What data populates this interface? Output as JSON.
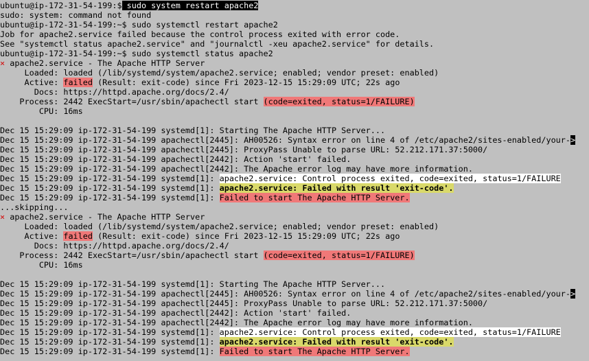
{
  "terminal": {
    "background": "#c0c0c0",
    "colors": {
      "prompt_highlight": "#000000",
      "failure_highlight": "#f07878",
      "notice_highlight": "#ffffff",
      "warning_highlight": "#d9d96a",
      "status_x": "#d40000"
    },
    "lines": [
      {
        "segs": [
          {
            "t": "ubuntu@ip-172-31-54-199:$",
            "s": "plain"
          },
          {
            "t": " sudo system restart apache2",
            "s": "black"
          }
        ]
      },
      {
        "segs": [
          {
            "t": "sudo: system: command not found",
            "s": "plain"
          }
        ]
      },
      {
        "segs": [
          {
            "t": "ubuntu@ip-172-31-54-199:~$ sudo systemctl restart apache2",
            "s": "plain"
          }
        ]
      },
      {
        "segs": [
          {
            "t": "Job for apache2.service failed because the control process exited with error code.",
            "s": "plain"
          }
        ]
      },
      {
        "segs": [
          {
            "t": "See \"systemctl status apache2.service\" and \"journalctl -xeu apache2.service\" for details.",
            "s": "plain"
          }
        ]
      },
      {
        "segs": [
          {
            "t": "ubuntu@ip-172-31-54-199:~$ sudo systemctl status apache2",
            "s": "plain"
          }
        ]
      },
      {
        "segs": [
          {
            "t": "×",
            "s": "x"
          },
          {
            "t": " apache2.service - The Apache HTTP Server",
            "s": "plain"
          }
        ]
      },
      {
        "segs": [
          {
            "t": "     Loaded: loaded (/lib/systemd/system/apache2.service; enabled; vendor preset: enabled)",
            "s": "plain"
          }
        ]
      },
      {
        "segs": [
          {
            "t": "     Active: ",
            "s": "plain"
          },
          {
            "t": "failed",
            "s": "red"
          },
          {
            "t": " (Result: exit-code) since Fri 2023-12-15 15:29:09 UTC; 22s ago",
            "s": "plain"
          }
        ]
      },
      {
        "segs": [
          {
            "t": "       Docs: https://httpd.apache.org/docs/2.4/",
            "s": "plain"
          }
        ]
      },
      {
        "segs": [
          {
            "t": "    Process: 2442 ExecStart=/usr/sbin/apachectl start ",
            "s": "plain"
          },
          {
            "t": "(code=exited, status=1/FAILURE)",
            "s": "red"
          }
        ]
      },
      {
        "segs": [
          {
            "t": "        CPU: 16ms",
            "s": "plain"
          }
        ]
      },
      {
        "segs": [
          {
            "t": "",
            "s": "plain"
          }
        ]
      },
      {
        "segs": [
          {
            "t": "Dec 15 15:29:09 ip-172-31-54-199 systemd[1]: Starting The Apache HTTP Server...",
            "s": "plain"
          }
        ]
      },
      {
        "segs": [
          {
            "t": "Dec 15 15:29:09 ip-172-31-54-199 apachectl[2445]: AH00526: Syntax error on line 4 of /etc/apache2/sites-enabled/your-",
            "s": "plain"
          },
          {
            "t": ">",
            "s": "black"
          }
        ]
      },
      {
        "segs": [
          {
            "t": "Dec 15 15:29:09 ip-172-31-54-199 apachectl[2445]: ProxyPass Unable to parse URL: 52.212.171.37:5000/",
            "s": "plain"
          }
        ]
      },
      {
        "segs": [
          {
            "t": "Dec 15 15:29:09 ip-172-31-54-199 apachectl[2442]: Action 'start' failed.",
            "s": "plain"
          }
        ]
      },
      {
        "segs": [
          {
            "t": "Dec 15 15:29:09 ip-172-31-54-199 apachectl[2442]: The Apache error log may have more information.",
            "s": "plain"
          }
        ]
      },
      {
        "segs": [
          {
            "t": "Dec 15 15:29:09 ip-172-31-54-199 systemd[1]: ",
            "s": "plain"
          },
          {
            "t": "apache2.service: Control process exited, code=exited, status=1/FAILURE",
            "s": "white"
          }
        ]
      },
      {
        "segs": [
          {
            "t": "Dec 15 15:29:09 ip-172-31-54-199 systemd[1]: ",
            "s": "plain"
          },
          {
            "t": "apache2.service: Failed with result 'exit-code'.",
            "s": "yellow"
          }
        ]
      },
      {
        "segs": [
          {
            "t": "Dec 15 15:29:09 ip-172-31-54-199 systemd[1]: ",
            "s": "plain"
          },
          {
            "t": "Failed to start The Apache HTTP Server.",
            "s": "red"
          }
        ]
      },
      {
        "segs": [
          {
            "t": "...skipping...",
            "s": "plain"
          }
        ]
      },
      {
        "segs": [
          {
            "t": "×",
            "s": "x"
          },
          {
            "t": " apache2.service - The Apache HTTP Server",
            "s": "plain"
          }
        ]
      },
      {
        "segs": [
          {
            "t": "     Loaded: loaded (/lib/systemd/system/apache2.service; enabled; vendor preset: enabled)",
            "s": "plain"
          }
        ]
      },
      {
        "segs": [
          {
            "t": "     Active: ",
            "s": "plain"
          },
          {
            "t": "failed",
            "s": "red"
          },
          {
            "t": " (Result: exit-code) since Fri 2023-12-15 15:29:09 UTC; 22s ago",
            "s": "plain"
          }
        ]
      },
      {
        "segs": [
          {
            "t": "       Docs: https://httpd.apache.org/docs/2.4/",
            "s": "plain"
          }
        ]
      },
      {
        "segs": [
          {
            "t": "    Process: 2442 ExecStart=/usr/sbin/apachectl start ",
            "s": "plain"
          },
          {
            "t": "(code=exited, status=1/FAILURE)",
            "s": "red"
          }
        ]
      },
      {
        "segs": [
          {
            "t": "        CPU: 16ms",
            "s": "plain"
          }
        ]
      },
      {
        "segs": [
          {
            "t": "",
            "s": "plain"
          }
        ]
      },
      {
        "segs": [
          {
            "t": "Dec 15 15:29:09 ip-172-31-54-199 systemd[1]: Starting The Apache HTTP Server...",
            "s": "plain"
          }
        ]
      },
      {
        "segs": [
          {
            "t": "Dec 15 15:29:09 ip-172-31-54-199 apachectl[2445]: AH00526: Syntax error on line 4 of /etc/apache2/sites-enabled/your-",
            "s": "plain"
          },
          {
            "t": ">",
            "s": "black"
          }
        ]
      },
      {
        "segs": [
          {
            "t": "Dec 15 15:29:09 ip-172-31-54-199 apachectl[2445]: ProxyPass Unable to parse URL: 52.212.171.37:5000/",
            "s": "plain"
          }
        ]
      },
      {
        "segs": [
          {
            "t": "Dec 15 15:29:09 ip-172-31-54-199 apachectl[2442]: Action 'start' failed.",
            "s": "plain"
          }
        ]
      },
      {
        "segs": [
          {
            "t": "Dec 15 15:29:09 ip-172-31-54-199 apachectl[2442]: The Apache error log may have more information.",
            "s": "plain"
          }
        ]
      },
      {
        "segs": [
          {
            "t": "Dec 15 15:29:09 ip-172-31-54-199 systemd[1]: ",
            "s": "plain"
          },
          {
            "t": "apache2.service: Control process exited, code=exited, status=1/FAILURE",
            "s": "white"
          }
        ]
      },
      {
        "segs": [
          {
            "t": "Dec 15 15:29:09 ip-172-31-54-199 systemd[1]: ",
            "s": "plain"
          },
          {
            "t": "apache2.service: Failed with result 'exit-code'.",
            "s": "yellow"
          }
        ]
      },
      {
        "segs": [
          {
            "t": "Dec 15 15:29:09 ip-172-31-54-199 systemd[1]: ",
            "s": "plain"
          },
          {
            "t": "Failed to start The Apache HTTP Server.",
            "s": "red"
          }
        ]
      }
    ]
  }
}
